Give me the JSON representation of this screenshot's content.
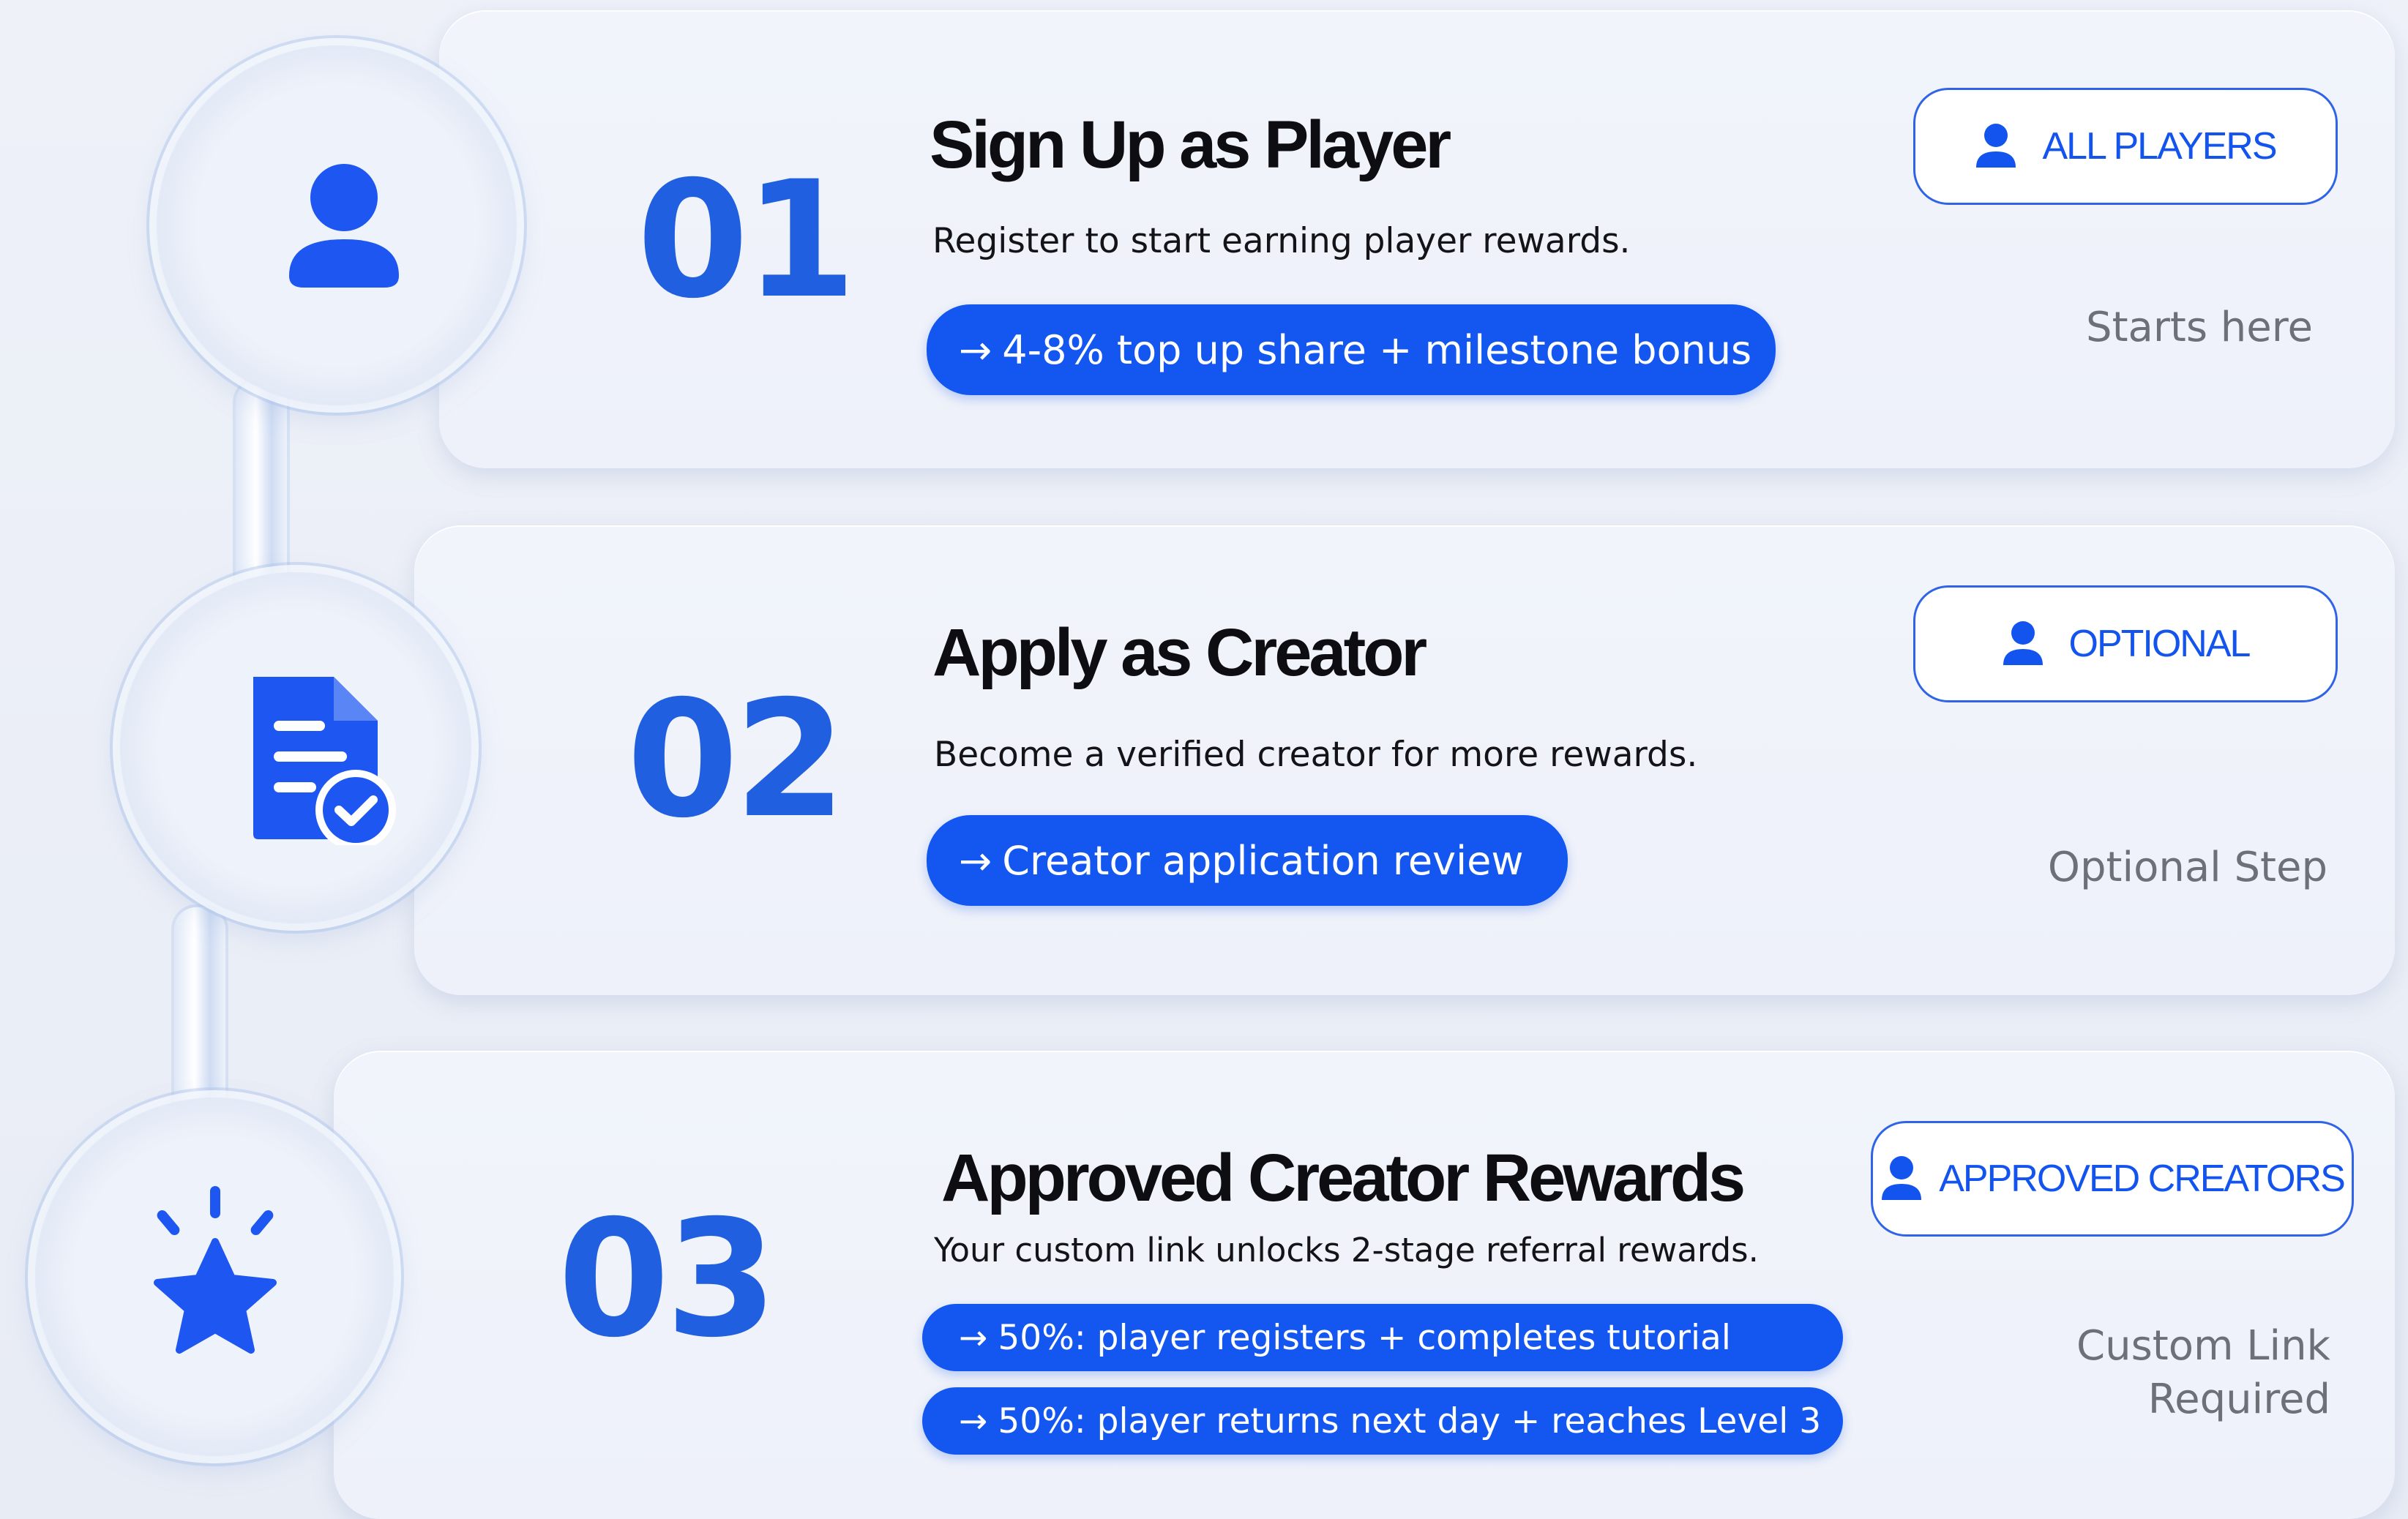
{
  "colors": {
    "accent": "#1357f0",
    "number": "#1f5fe0",
    "title": "#0d0d12",
    "note": "#6e7077",
    "background": "#eef1f8"
  },
  "steps": [
    {
      "number": "01",
      "title": "Sign Up as Player",
      "description": "Register to start earning player rewards.",
      "pills": [
        "4-8% top up share + milestone bonus"
      ],
      "badge": "ALL PLAYERS",
      "note": [
        "Starts here"
      ],
      "icon": "user-icon"
    },
    {
      "number": "02",
      "title": "Apply as Creator",
      "description": "Become a verified creator for more rewards.",
      "pills": [
        "Creator application review"
      ],
      "badge": "OPTIONAL",
      "note": [
        "Optional Step"
      ],
      "icon": "document-check-icon"
    },
    {
      "number": "03",
      "title": "Approved Creator Rewards",
      "description": "Your custom link unlocks 2-stage referral rewards.",
      "pills": [
        "50%: player registers + completes tutorial",
        "50%: player returns next day + reaches Level 3"
      ],
      "badge": "APPROVED CREATORS",
      "note": [
        "Custom Link",
        "Required"
      ],
      "icon": "star-icon"
    }
  ]
}
